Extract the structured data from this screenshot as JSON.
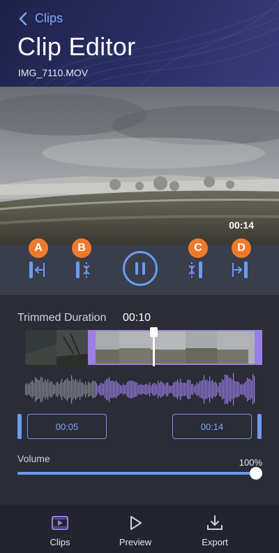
{
  "header": {
    "back_label": "Clips",
    "title": "Clip Editor",
    "filename": "IMG_7110.MOV"
  },
  "video": {
    "timestamp": "00:14"
  },
  "controls": {
    "a_label": "A",
    "b_label": "B",
    "c_label": "C",
    "d_label": "D",
    "play_state": "playing",
    "icons": [
      "trim-start-left-icon",
      "split-start-icon",
      "pause-icon",
      "split-end-icon",
      "trim-end-right-icon"
    ]
  },
  "trim": {
    "duration_label": "Trimmed Duration",
    "duration_value": "00:10",
    "start_time": "00:05",
    "end_time": "00:14"
  },
  "volume": {
    "label": "Volume",
    "value": "100%",
    "level": 1.0
  },
  "tabbar": {
    "tabs": [
      {
        "label": "Clips",
        "icon": "clips-icon"
      },
      {
        "label": "Preview",
        "icon": "play-icon"
      },
      {
        "label": "Export",
        "icon": "download-icon"
      }
    ]
  },
  "colors": {
    "accent": "#6a9cf4",
    "selection": "#9b7ee6",
    "badge": "#f07a2c",
    "header_bg": "#2a2f66"
  }
}
